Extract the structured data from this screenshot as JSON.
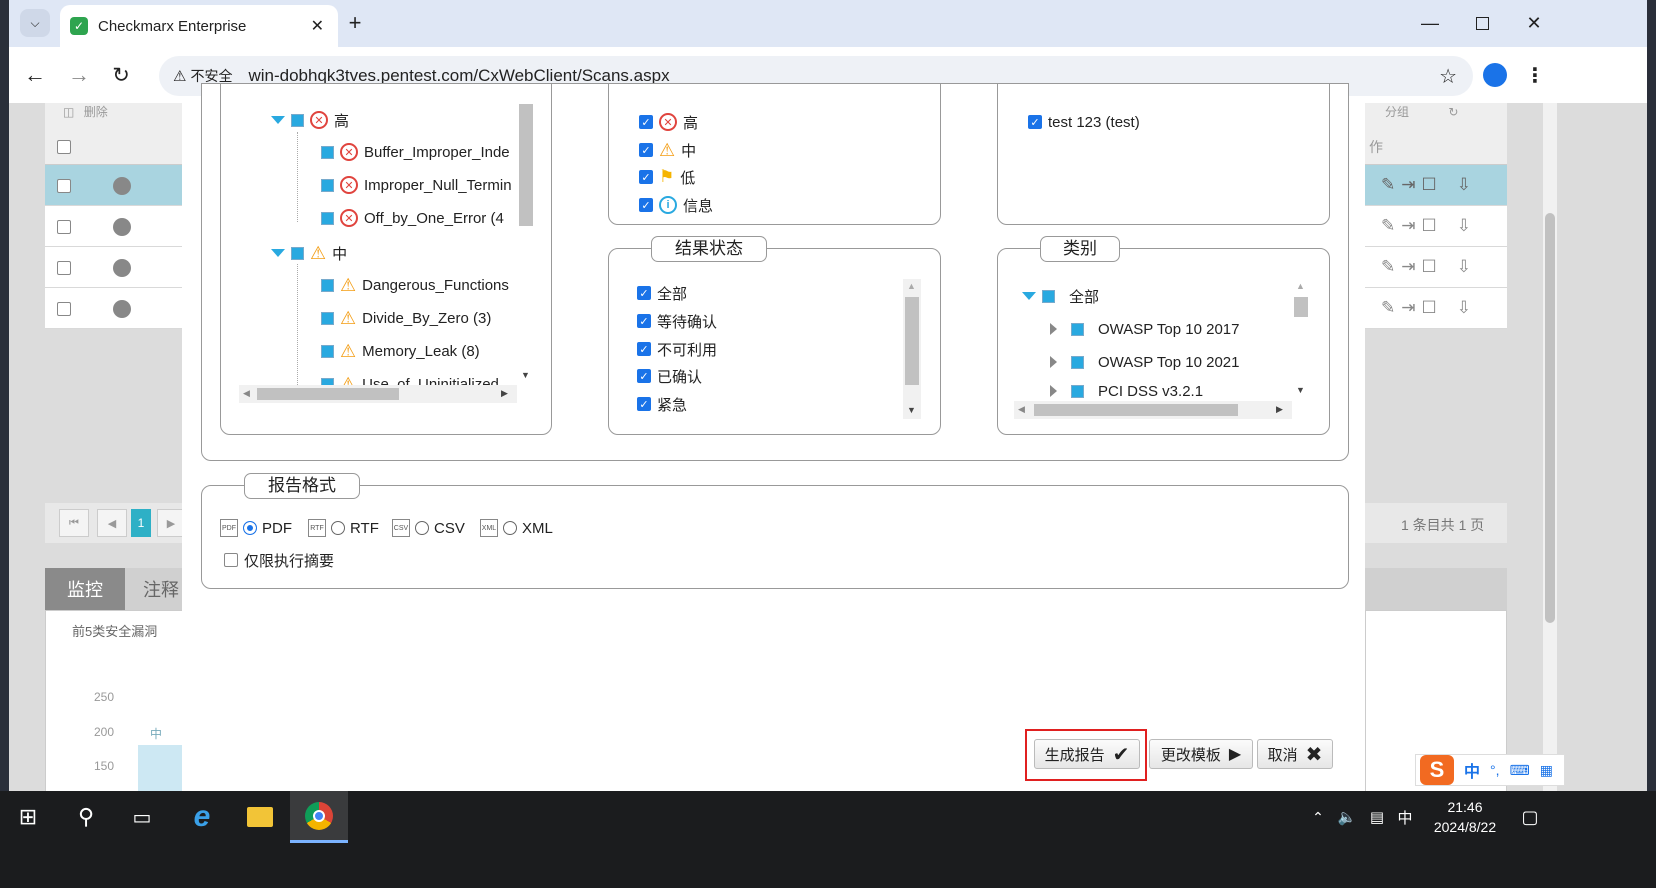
{
  "browser": {
    "tab_title": "Checkmarx Enterprise",
    "security_label": "不安全",
    "url": "win-dobhqk3tves.pentest.com/CxWebClient/Scans.aspx"
  },
  "background": {
    "toolbar_delete": "删除",
    "pagination_current": "1",
    "pagination_summary": "1 条目共 1 页",
    "tab_monitor": "监控",
    "tab_notes": "注释",
    "chart_title": "前5类安全漏洞",
    "axis_ticks": [
      "250",
      "200",
      "150"
    ],
    "bar_label": "中",
    "toolbar_group": "分组",
    "col_action": "作"
  },
  "severity_tree": {
    "high_label": "高",
    "high_items": [
      "Buffer_Improper_Inde",
      "Improper_Null_Termin",
      "Off_by_One_Error  (4"
    ],
    "medium_label": "中",
    "medium_items": [
      "Dangerous_Functions",
      "Divide_By_Zero  (3)",
      "Memory_Leak  (8)",
      "Use_of_Uninitialized_"
    ]
  },
  "severity_filter": {
    "items": [
      {
        "label": "高",
        "icon": "error-icon"
      },
      {
        "label": "中",
        "icon": "warning-icon"
      },
      {
        "label": "低",
        "icon": "flag-icon"
      },
      {
        "label": "信息",
        "icon": "info-icon"
      }
    ]
  },
  "project_filter": {
    "items": [
      "test 123 (test)"
    ]
  },
  "result_status": {
    "legend": "结果状态",
    "items": [
      "全部",
      "等待确认",
      "不可利用",
      "已确认",
      "紧急"
    ]
  },
  "category": {
    "legend": "类别",
    "root": "全部",
    "items": [
      "OWASP Top 10 2017",
      "OWASP Top 10 2021",
      "PCI DSS v3.2.1"
    ]
  },
  "report_format": {
    "legend": "报告格式",
    "options": [
      "PDF",
      "RTF",
      "CSV",
      "XML"
    ],
    "selected": "PDF",
    "summary_only": "仅限执行摘要"
  },
  "actions": {
    "generate": "生成报告",
    "change_template": "更改模板",
    "cancel": "取消"
  },
  "taskbar": {
    "time": "21:46",
    "date": "2024/8/22",
    "ime_lang": "中",
    "ime_tray_lang": "中"
  }
}
